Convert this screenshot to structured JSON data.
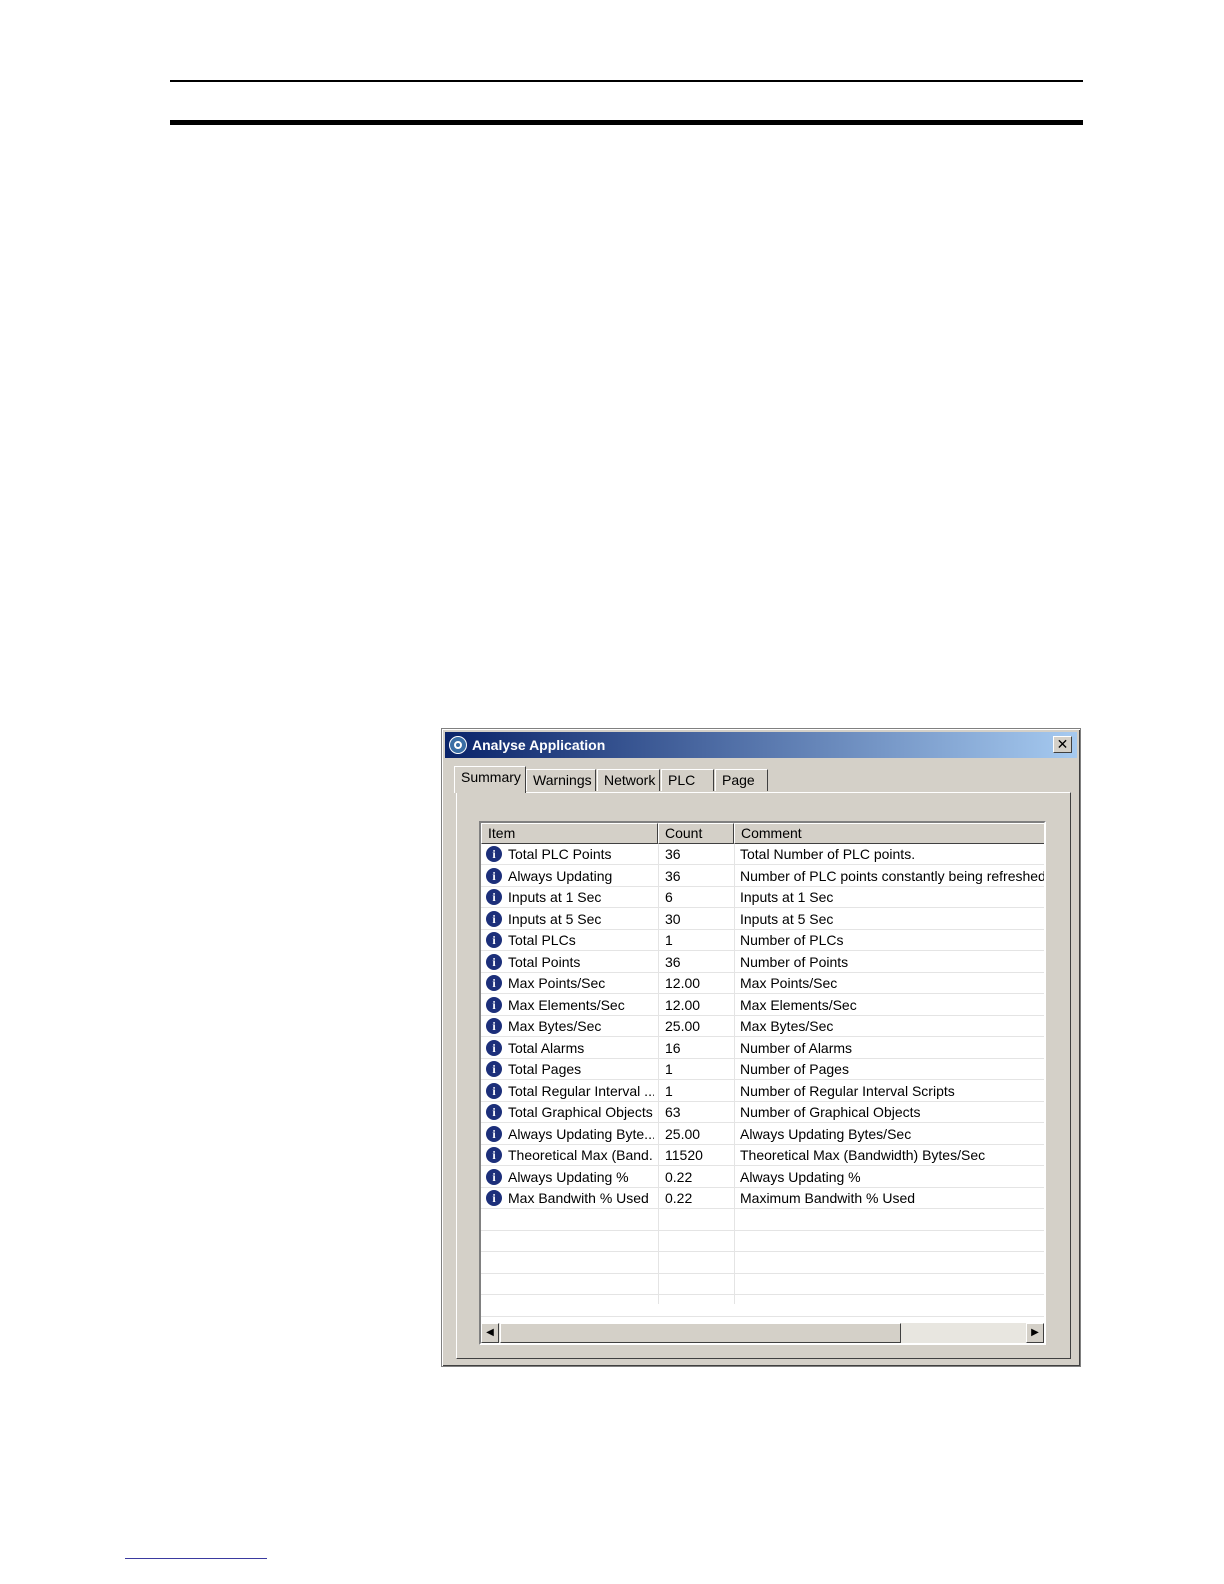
{
  "window": {
    "title": "Analyse Application",
    "close_glyph": "✕"
  },
  "tabs": [
    "Summary",
    "Warnings",
    "Network",
    "PLC",
    "Page"
  ],
  "columns": [
    "Item",
    "Count",
    "Comment"
  ],
  "rows": [
    {
      "item": "Total PLC Points",
      "count": "36",
      "comment": "Total Number of PLC points."
    },
    {
      "item": "Always Updating",
      "count": "36",
      "comment": "Number of PLC points constantly being refreshed."
    },
    {
      "item": "Inputs at 1 Sec",
      "count": "6",
      "comment": "Inputs at 1 Sec"
    },
    {
      "item": "Inputs at 5 Sec",
      "count": "30",
      "comment": "Inputs at 5 Sec"
    },
    {
      "item": "Total PLCs",
      "count": "1",
      "comment": "Number of PLCs"
    },
    {
      "item": "Total Points",
      "count": "36",
      "comment": "Number of Points"
    },
    {
      "item": "Max Points/Sec",
      "count": "12.00",
      "comment": "Max Points/Sec"
    },
    {
      "item": "Max Elements/Sec",
      "count": "12.00",
      "comment": "Max Elements/Sec"
    },
    {
      "item": "Max Bytes/Sec",
      "count": "25.00",
      "comment": "Max Bytes/Sec"
    },
    {
      "item": "Total Alarms",
      "count": "16",
      "comment": "Number of Alarms"
    },
    {
      "item": "Total Pages",
      "count": "1",
      "comment": "Number of Pages"
    },
    {
      "item": "Total Regular Interval ...",
      "count": "1",
      "comment": "Number of Regular Interval Scripts"
    },
    {
      "item": "Total Graphical Objects",
      "count": "63",
      "comment": "Number of Graphical Objects"
    },
    {
      "item": "Always Updating Byte...",
      "count": "25.00",
      "comment": "Always Updating Bytes/Sec"
    },
    {
      "item": "Theoretical Max (Band...",
      "count": "11520",
      "comment": "Theoretical Max (Bandwidth) Bytes/Sec"
    },
    {
      "item": "Always Updating %",
      "count": "0.22",
      "comment": "Always Updating %"
    },
    {
      "item": "Max Bandwith % Used",
      "count": "0.22",
      "comment": "Maximum Bandwith % Used"
    }
  ],
  "scrollbar": {
    "left_arrow": "◀",
    "right_arrow": "▶"
  },
  "colors": {
    "title_start": "#0a246a",
    "title_end": "#a6caf0",
    "dialog_bg": "#d4d0c8",
    "info_icon": "#1c2f7a"
  }
}
